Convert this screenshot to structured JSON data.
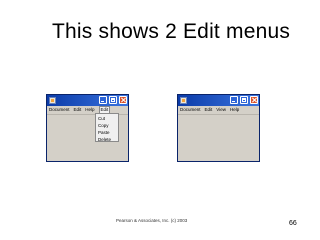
{
  "slide": {
    "title": "This shows 2 Edit menus",
    "footer": "Pearson & Associates, Inc. (c) 2003",
    "page_number": "66"
  },
  "left_window": {
    "menu": [
      "Document",
      "Edit",
      "Help",
      "Edit"
    ],
    "active_menu_index": 3,
    "dropdown_items": [
      "Cut",
      "Copy",
      "Paste",
      "Delete"
    ]
  },
  "right_window": {
    "menu": [
      "Document",
      "Edit",
      "View",
      "Help"
    ]
  },
  "icons": {
    "window_icon": "app-icon",
    "minimize": "minimize-icon",
    "maximize": "maximize-icon",
    "close": "close-icon"
  },
  "colors": {
    "titlebar": "#0b3ba8",
    "close_button": "#d9532c",
    "window_body": "#d4d0c8"
  }
}
